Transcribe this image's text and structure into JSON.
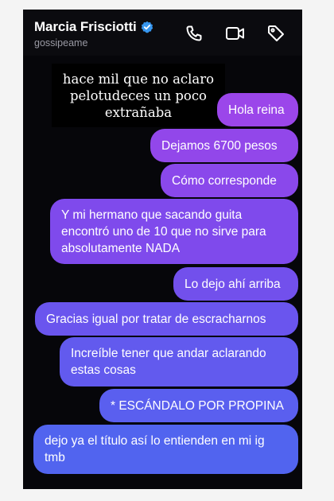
{
  "header": {
    "name": "Marcia Frisciotti",
    "handle": "gossipeame",
    "icons": [
      "verified-badge-icon",
      "phone-icon",
      "video-camera-icon",
      "tag-icon"
    ]
  },
  "overlay_caption": "hace mil que no aclaro\npelotudeces un poco\nextrañaba",
  "messages": [
    {
      "text": "Hola reina",
      "color": "#9b46ea"
    },
    {
      "text": "Dejamos 6700 pesos",
      "color": "#9247ea"
    },
    {
      "text": "Cómo corresponde",
      "color": "#8a48eb"
    },
    {
      "text": "Y mi hermano que sacando guita\nencontró uno de 10 que no sirve para\nabsolutamente NADA",
      "color": "#7f4aec"
    },
    {
      "text": "Lo dejo ahí arriba",
      "color": "#7250ec"
    },
    {
      "text": "Gracias igual por tratar de escracharnos",
      "color": "#6a55ee"
    },
    {
      "text": "Increíble tener que andar aclarando\nestas cosas",
      "color": "#625aee"
    },
    {
      "text": "* ESCÁNDALO POR PROPINA",
      "color": "#5a5fef"
    },
    {
      "text": "dejo ya el título así lo entienden en mi ig\ntmb",
      "color": "#5164ef"
    }
  ]
}
